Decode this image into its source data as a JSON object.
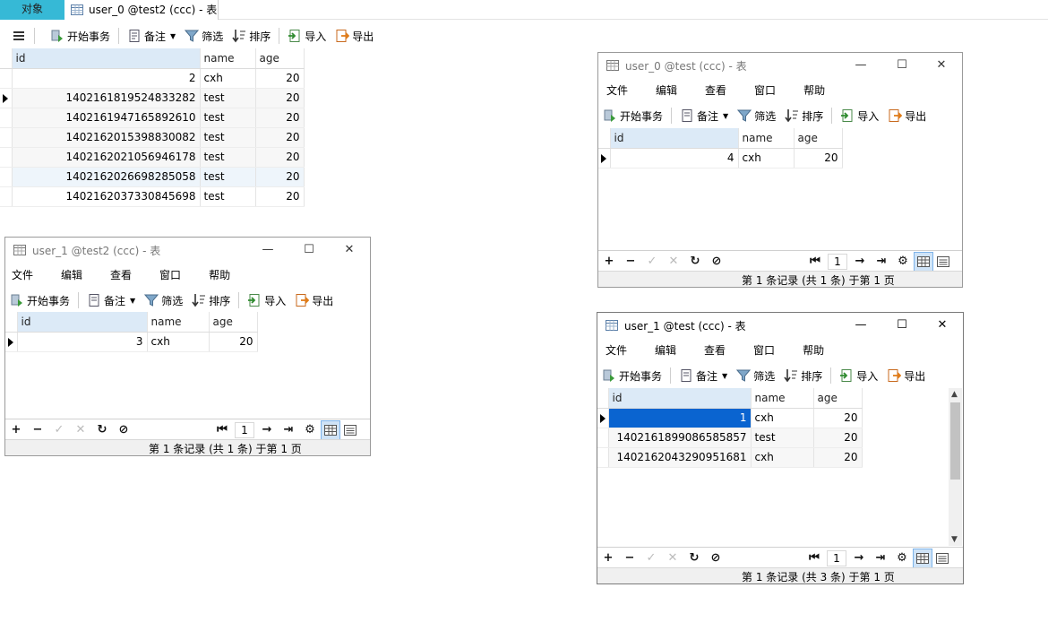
{
  "tabs": {
    "objects_label": "对象",
    "table_tab_label": "user_0 @test2 (ccc) - 表"
  },
  "main_toolbar": {
    "begin_txn": "开始事务",
    "memo": "备注",
    "filter": "筛选",
    "sort": "排序",
    "import": "导入",
    "export": "导出"
  },
  "main_grid": {
    "columns": [
      "id",
      "name",
      "age"
    ],
    "rows": [
      {
        "id": "2",
        "name": "cxh",
        "age": "20"
      },
      {
        "id": "1402161819524833282",
        "name": "test",
        "age": "20"
      },
      {
        "id": "1402161947165892610",
        "name": "test",
        "age": "20"
      },
      {
        "id": "1402162015398830082",
        "name": "test",
        "age": "20"
      },
      {
        "id": "1402162021056946178",
        "name": "test",
        "age": "20"
      },
      {
        "id": "1402162026698285058",
        "name": "test",
        "age": "20"
      },
      {
        "id": "1402162037330845698",
        "name": "test",
        "age": "20"
      }
    ]
  },
  "menus": {
    "file": "文件",
    "edit": "编辑",
    "view": "查看",
    "window": "窗口",
    "help": "帮助"
  },
  "windows": {
    "w_user0_test": {
      "title": "user_0 @test (ccc) - 表",
      "columns": [
        "id",
        "name",
        "age"
      ],
      "rows": [
        {
          "id": "4",
          "name": "cxh",
          "age": "20"
        }
      ],
      "page": "1",
      "status": "第 1 条记录 (共 1 条) 于第 1 页"
    },
    "w_user1_test2": {
      "title": "user_1 @test2 (ccc) - 表",
      "columns": [
        "id",
        "name",
        "age"
      ],
      "rows": [
        {
          "id": "3",
          "name": "cxh",
          "age": "20"
        }
      ],
      "page": "1",
      "status": "第 1 条记录 (共 1 条) 于第 1 页"
    },
    "w_user1_test": {
      "title": "user_1 @test (ccc) - 表",
      "columns": [
        "id",
        "name",
        "age"
      ],
      "rows": [
        {
          "id": "1",
          "name": "cxh",
          "age": "20"
        },
        {
          "id": "1402161899086585857",
          "name": "test",
          "age": "20"
        },
        {
          "id": "1402162043290951681",
          "name": "cxh",
          "age": "20"
        }
      ],
      "page": "1",
      "status": "第 1 条记录 (共 3 条) 于第 1 页"
    }
  },
  "window_controls": {
    "minimize": "—",
    "maximize": "☐",
    "close": "✕"
  },
  "nav_glyphs": {
    "add": "+",
    "remove": "−",
    "apply": "✓",
    "cancel": "✕",
    "refresh": "↻",
    "stop": "⊘",
    "first": "⏮",
    "next": "→",
    "last": "⇥",
    "settings": "⚙"
  }
}
